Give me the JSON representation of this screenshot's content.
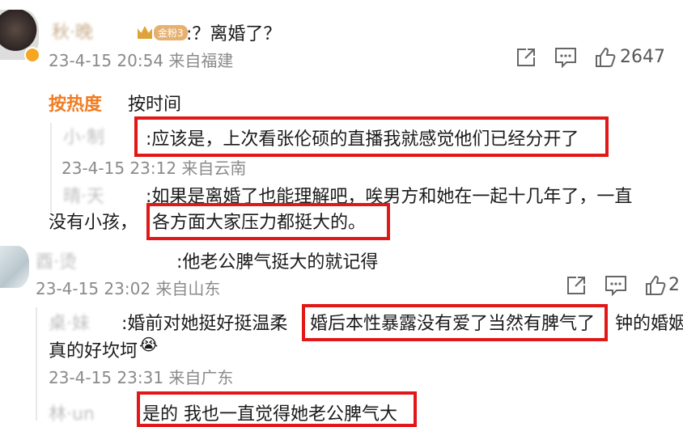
{
  "top_comment": {
    "username": "秋·晚",
    "badge_text": "金粉3",
    "text": ":？离婚了？",
    "time_location": "23-4-15 20:54 来自福建",
    "like_count": "2647"
  },
  "sort_tabs": {
    "hot": "按热度",
    "time": "按时间"
  },
  "replies_1": [
    {
      "username": "小·制",
      "text": ":应该是，上次看张伦硕的直播我就感觉他们已经分开了",
      "time_location": "23-4-15 23:12 来自云南"
    },
    {
      "username": "晴·天",
      "text_line1": ":如果是离婚了也能理解吧，唉男方和她在一起十几年了，一直",
      "text_line2_a": "没有小孩，",
      "text_line2_b": "各方面大家压力都挺大的。"
    }
  ],
  "second_comment": {
    "username": "酉·烫",
    "text": ":他老公脾气挺大的就记得",
    "time_location": "23-4-15 23:02 来自山东",
    "like_count": "2"
  },
  "replies_2": [
    {
      "username": "桌·妹",
      "text_a": ":婚前对她挺好挺温柔",
      "text_b": "婚后本性暴露没有爱了当然有脾气了",
      "text_c": "钟的婚姻",
      "text_line2": "真的好坎坷",
      "emoji": "😭",
      "time_location": "23-4-15 23:31 来自广东"
    },
    {
      "username": "林·un",
      "text": "是的 我也一直觉得她老公脾气大"
    }
  ],
  "colors": {
    "highlight_box": "#e01818",
    "active_tab": "#f07b20",
    "meta_gray": "#8a8a8a"
  }
}
